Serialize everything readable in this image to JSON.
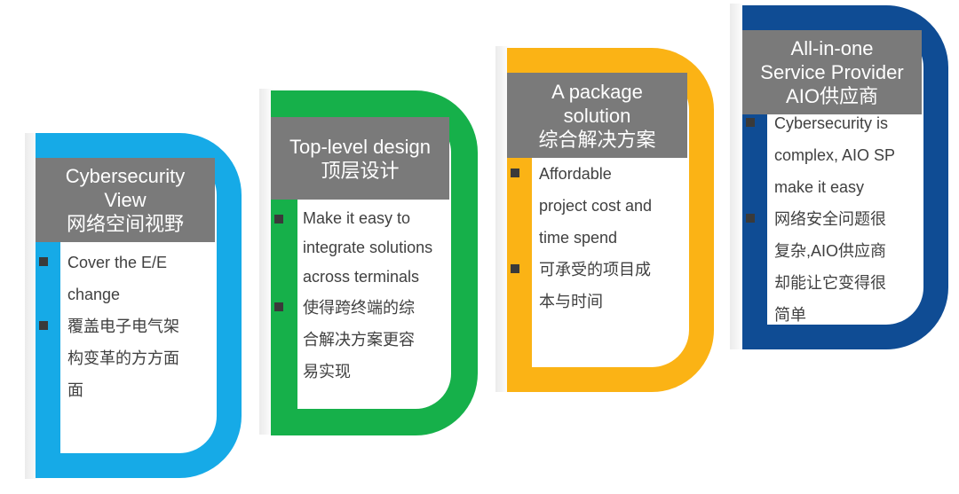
{
  "colors": {
    "card1": "#16aae7",
    "card2": "#16b04a",
    "card3": "#fbb315",
    "card4": "#0f4c94",
    "header": "#7a7a7a"
  },
  "cards": [
    {
      "title": [
        "Cybersecurity",
        "View",
        "网络空间视野"
      ],
      "bullets": [
        [
          "Cover the E/E",
          "change"
        ],
        [
          "覆盖电子电气架",
          "构变革的方方面",
          "面"
        ]
      ]
    },
    {
      "title": [
        "Top-level design",
        "顶层设计"
      ],
      "bullets": [
        [
          "Make it easy to",
          "integrate solutions",
          "across terminals"
        ],
        [
          "使得跨终端的综",
          "合解决方案更容",
          "易实现"
        ]
      ]
    },
    {
      "title": [
        "A package",
        "solution",
        "综合解决方案"
      ],
      "bullets": [
        [
          "Affordable",
          "project cost and",
          "time spend"
        ],
        [
          "可承受的项目成",
          "本与时间"
        ]
      ]
    },
    {
      "title": [
        "All-in-one",
        "Service Provider",
        "AIO供应商"
      ],
      "bullets": [
        [
          "Cybersecurity is",
          "complex, AIO SP",
          "make it easy"
        ],
        [
          "网络安全问题很",
          "复杂,AIO供应商",
          "却能让它变得很",
          "简单"
        ]
      ]
    }
  ]
}
